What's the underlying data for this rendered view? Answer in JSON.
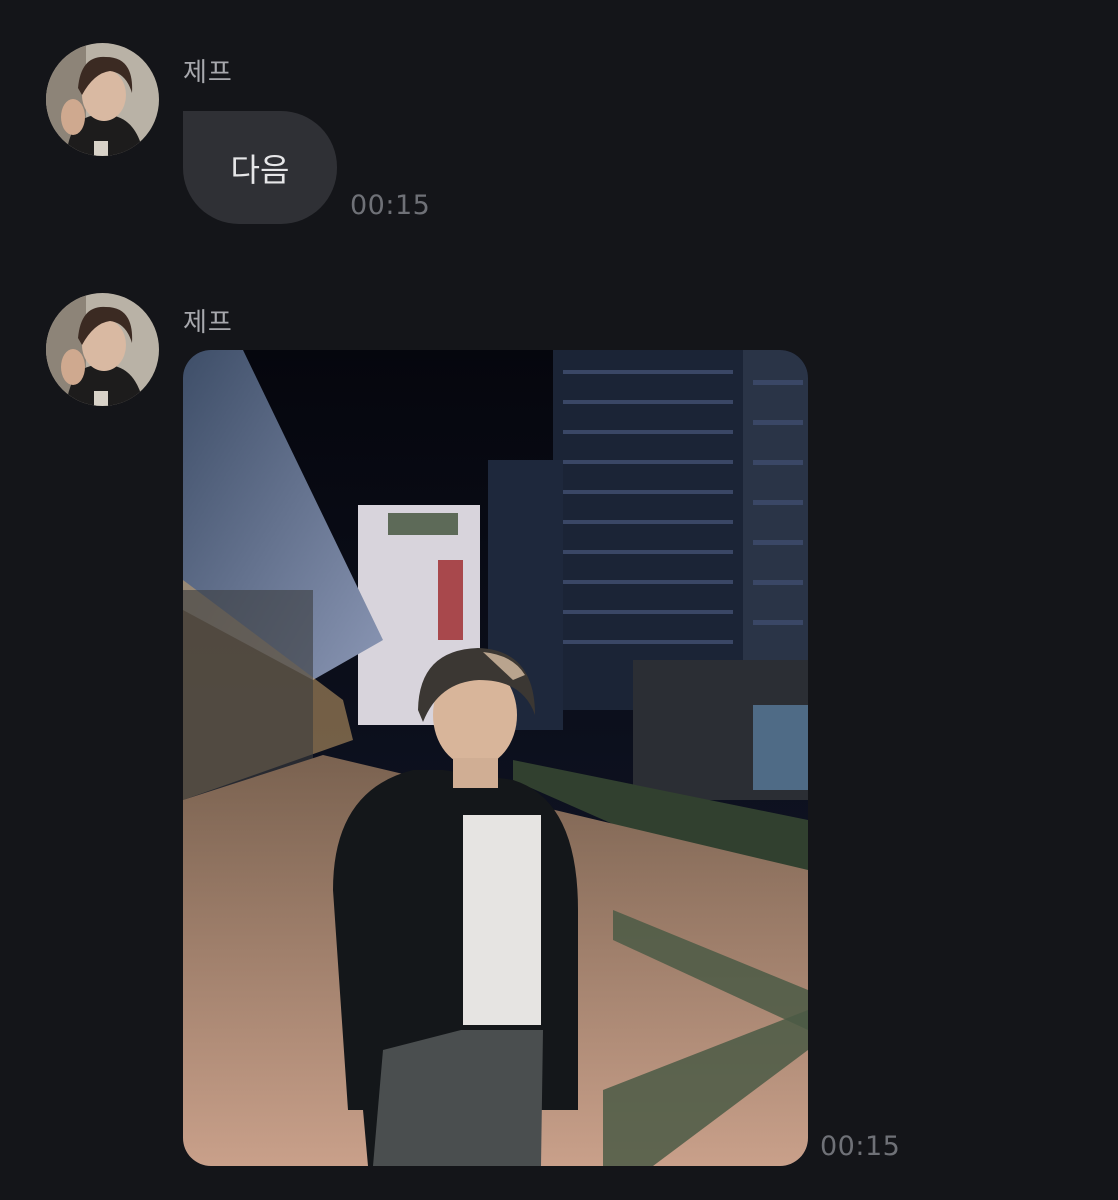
{
  "messages": [
    {
      "sender": "제프",
      "text": "다음",
      "time": "00:15",
      "avatar": "profile-photo"
    },
    {
      "sender": "제프",
      "attachment": "photo",
      "time": "00:15",
      "avatar": "profile-photo"
    }
  ],
  "colors": {
    "background": "#141519",
    "bubble": "#2f3035",
    "sender_text": "#a7a8ad",
    "timestamp_text": "#6f7177"
  }
}
